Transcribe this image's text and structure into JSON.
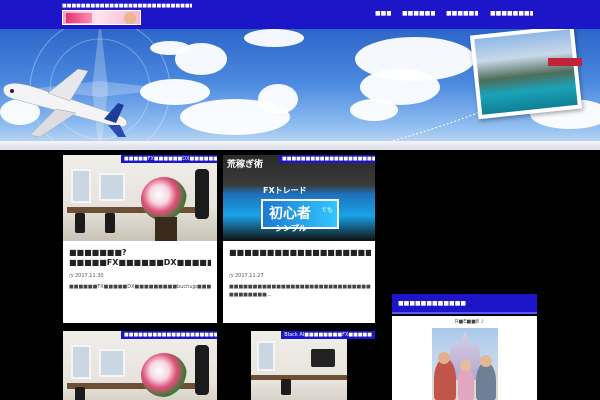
{
  "header": {
    "site_description": "■■■■■■■■■■■■■■■■■■■■■■■■■■■■■■■■■■■■■■■■■■",
    "logo_icon": "site-logo-banner"
  },
  "nav": {
    "items": [
      {
        "label": "■■■■"
      },
      {
        "label": "■■■■■■■■■■"
      },
      {
        "label": "■■■■■■■■■"
      },
      {
        "label": "■■■■■■■■■■■■■■■"
      }
    ]
  },
  "hero": {
    "icons": [
      "airplane-icon",
      "compass-icon",
      "postcard-lake-photo"
    ]
  },
  "cards": [
    {
      "category": "■■■■■FX■■■■■■DX■■■■■■■",
      "title": "■■■■■■■?■■■■■FX■■■■■■DX■■■■■■■■■■ buchujp■■■■■■■■■■■■■■■■■",
      "date": "2017.11.30",
      "excerpt": "■■■■■■FX■■■■■DX■■■■■■■■■buchujp■■■■■■■■■■■■■■■■■■■■■■■■■■■■■■■■■■■■■■■■■■■■■■■■■■■■■■■■■■■■■■FX■■■■■■■■■■■■■■■■■■■■■■■■■■■■■■■■■■...",
      "thumb": "office-flowers-photo"
    },
    {
      "category": "■■■■■■■■■■■■■■■■■■■■■■■■■■",
      "title": "■■■■■■■■■■■■■■■■■■■■■■■■■■■■■■■■■■■■■■■■■■■■■■■■■buchujp■■■■■■■■■■■■",
      "date": "2017.11.27",
      "excerpt": "■■■■■■■■■■■■■■■■■■■■■■■■■■■■■■■■■■■■■■■■■■■■■■buchujp■■■■■■■■■■■■■■■FX■■■■■■■■■■■■■■■■■■■■■■■■■■■■■■■■■■■■■■■ ■■■■■■■■...",
      "thumb": "book-cover-photo",
      "book_text": {
        "top": "荒稼ぎ術",
        "mid": "FXトレード",
        "big": "初心者",
        "sub": "でも",
        "bottom": "シンプル"
      }
    },
    {
      "category": "■■■■■■■■■■■■■■■■■■■■FX■■",
      "thumb": "office-flowers-photo"
    },
    {
      "category": "Black AI■■■■■■■■FX■■■■■",
      "thumb": "office-monitor-photo"
    }
  ],
  "sidebar": {
    "heading": "■■■■■■■■■■■■",
    "caption": "R■E■■8        ♪",
    "photo": "family-castle-photo"
  },
  "colors": {
    "accent": "#1d15c8",
    "background": "#000000",
    "card": "#ffffff"
  }
}
